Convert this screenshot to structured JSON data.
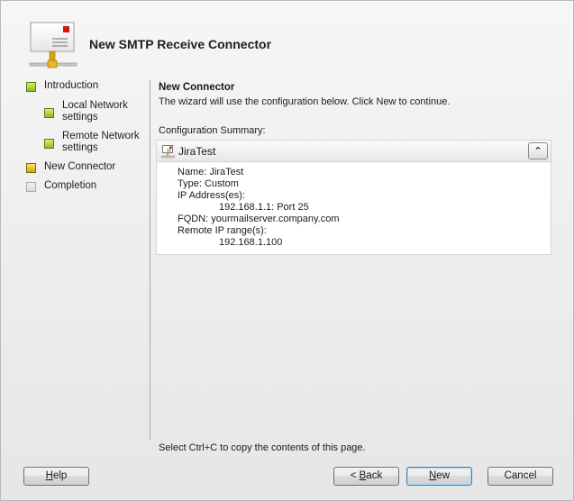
{
  "window": {
    "title": "New SMTP Receive Connector"
  },
  "sidebar": {
    "steps": [
      {
        "label_line1": "Introduction",
        "label_line2": "",
        "state": "done"
      },
      {
        "label_line1": "Local Network",
        "label_line2": "settings",
        "state": "done"
      },
      {
        "label_line1": "Remote Network",
        "label_line2": "settings",
        "state": "done"
      },
      {
        "label_line1": "New Connector",
        "label_line2": "",
        "state": "current"
      },
      {
        "label_line1": "Completion",
        "label_line2": "",
        "state": "pending"
      }
    ]
  },
  "main": {
    "section_title": "New Connector",
    "section_desc": "The wizard will use the configuration below.  Click New to continue.",
    "summary_label": "Configuration Summary:",
    "summary": {
      "connector_name": "JiraTest",
      "collapse_glyph": "˄",
      "lines": {
        "name": "Name: JiraTest",
        "type": "Type: Custom",
        "ip_label": "IP Address(es):",
        "ip_value": "192.168.1.1: Port 25",
        "fqdn": "FQDN: yourmailserver.company.com",
        "remote_label": "Remote IP range(s):",
        "remote_value": "192.168.1.100"
      }
    },
    "footer_hint": "Select Ctrl+C to copy the contents of this page."
  },
  "buttons": {
    "help": {
      "pre": "",
      "key": "H",
      "post": "elp"
    },
    "back": {
      "pre": "< ",
      "key": "B",
      "post": "ack"
    },
    "new": {
      "pre": "",
      "key": "N",
      "post": "ew"
    },
    "cancel": {
      "pre": "",
      "key": "",
      "post": "Cancel"
    }
  },
  "icons": {
    "header": "smtp-connector-wizard-icon",
    "summary": "connector-icon"
  }
}
